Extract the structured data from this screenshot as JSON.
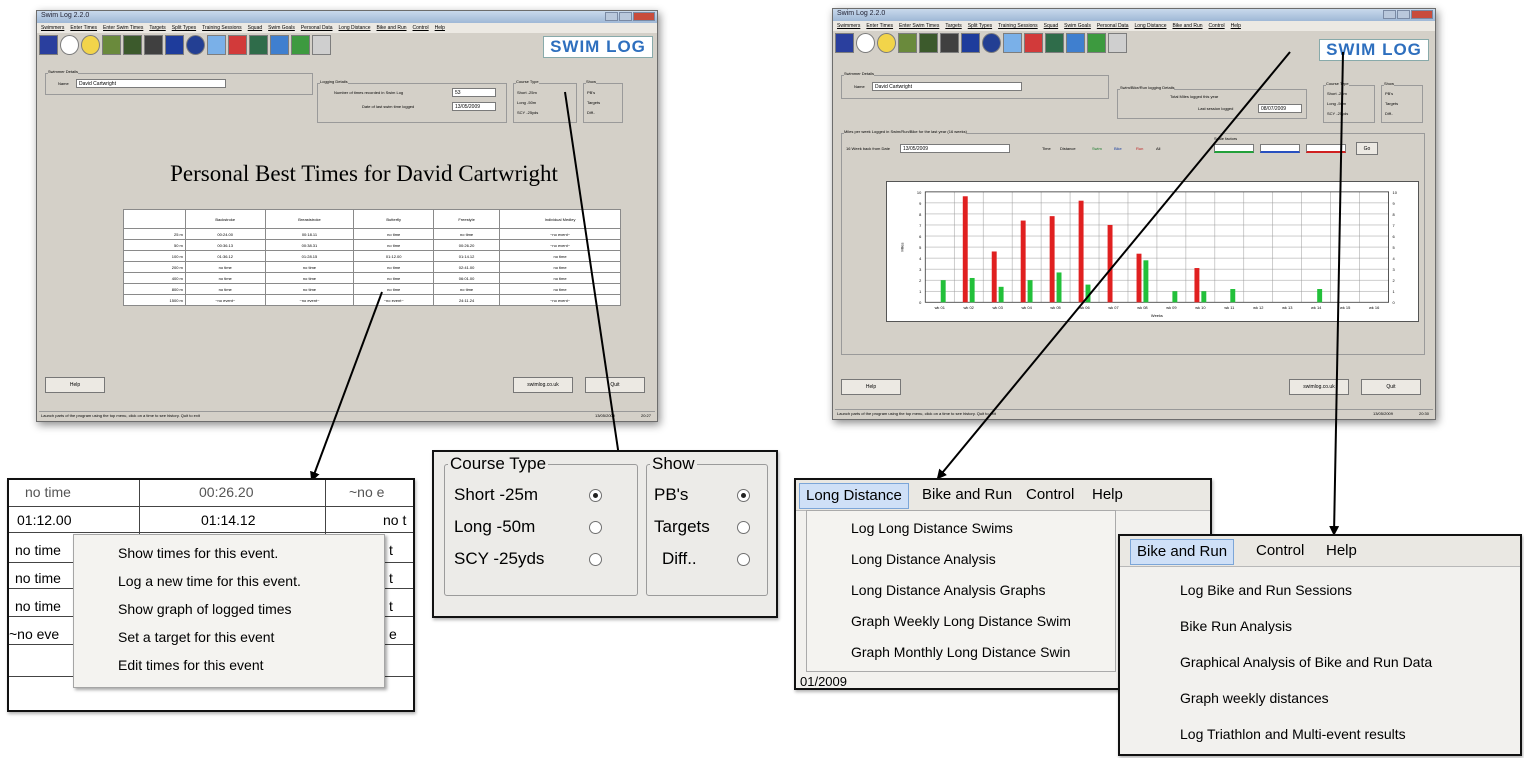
{
  "window_left": {
    "title": "Swim Log 2.2.0",
    "menu": [
      "Swimmers",
      "Enter Times",
      "Enter Swim Times",
      "Targets",
      "Split Types",
      "Training Sessions",
      "Squad",
      "Swim Goals",
      "Personal Data",
      "Long Distance",
      "Bike and Run",
      "Control",
      "Help"
    ],
    "logo": "SWIM LOG",
    "swimmer_details_label": "Swimmer Details",
    "name_label": "Name",
    "name_value": "David Cartwright",
    "logging_details_label": "Logging Details",
    "num_times_label": "Number of times recorded in Swim Log",
    "num_times_value": "53",
    "last_date_label": "Date of last swim time logged",
    "last_date_value": "13/05/2009",
    "course_type_label": "Course Type",
    "course_options": [
      "Short -25m",
      "Long -50m",
      "SCY -25yds"
    ],
    "show_label": "Show",
    "show_options": [
      "PB's",
      "Targets",
      "Diff.."
    ],
    "heading": "Personal Best Times for David Cartwright",
    "table": {
      "headers": [
        "",
        "Backstroke",
        "Breaststroke",
        "Butterfly",
        "Freestyle",
        "Individual Medley"
      ],
      "rows": [
        [
          "25 m",
          "00:24.00",
          "00:18.11",
          "no time",
          "no time",
          "~no event~"
        ],
        [
          "50 m",
          "00:36.13",
          "00:38.31",
          "no time",
          "00:26.20",
          "~no event~"
        ],
        [
          "100 m",
          "01:36.12",
          "01:28.15",
          "01:12.00",
          "01:14.12",
          "no time"
        ],
        [
          "200 m",
          "no time",
          "no time",
          "no time",
          "02:41.00",
          "no time"
        ],
        [
          "400 m",
          "no time",
          "no time",
          "no time",
          "06:01.00",
          "no time"
        ],
        [
          "800 m",
          "no time",
          "no time",
          "no time",
          "no time",
          "no time"
        ],
        [
          "1500 m",
          "~no event~",
          "~no event~",
          "~no event~",
          "24:11.24",
          "~no event~"
        ]
      ]
    },
    "help_button": "Help",
    "website_button": "swimlog.co.uk",
    "quit_button": "Quit",
    "status_text": "Launch parts of the program using the top menu, click on a time to see history. Quit to exit",
    "status_date": "13/05/2009",
    "status_time": "20:27"
  },
  "window_right": {
    "title": "Swim Log 2.2.0",
    "menu": [
      "Swimmers",
      "Enter Times",
      "Enter Swim Times",
      "Targets",
      "Split Types",
      "Training Sessions",
      "Squad",
      "Swim Goals",
      "Personal Data",
      "Long Distance",
      "Bike and Run",
      "Control",
      "Help"
    ],
    "logo": "SWIM LOG",
    "swimmer_details_label": "Swimmer Details",
    "name_label": "Name",
    "name_value": "David Cartwright",
    "bike_run_label": "Swim/Bike/Run logging Details",
    "total_miles_label": "Total Miles logged this year",
    "last_session_label": "Last session logged",
    "last_session_value": "08/07/2009",
    "course_type_label": "Course Type",
    "show_label": "Show",
    "miles_label": "Miles per week Logged in Swim/Run/Bike for the last year (16 weeks)",
    "week_back_label": "16 Week back from Date",
    "week_back_value": "13/05/2009",
    "time_label": "Time",
    "distance_label": "Distance",
    "swim_label": "Swim",
    "bike_label": "Bike",
    "run_label": "Run",
    "all_label": "All",
    "scale_label": "Scale factors",
    "go_button": "Go",
    "help_button": "Help",
    "website_button": "swimlog.co.uk",
    "quit_button": "Quit",
    "status_text": "Launch parts of the program using the top menu, click on a time to see history. Quit to exit",
    "status_date": "13/05/2009",
    "status_time": "20:30"
  },
  "chart_data": {
    "type": "bar",
    "ylabel": "Miles",
    "xlabel": "Weeks",
    "ylim": [
      0,
      10
    ],
    "categories": [
      "wk 01",
      "wk 02",
      "wk 03",
      "wk 04",
      "wk 05",
      "wk 06",
      "wk 07",
      "wk 08",
      "wk 09",
      "wk 10",
      "wk 11",
      "wk 12",
      "wk 13",
      "wk 14",
      "wk 15",
      "wk 16"
    ],
    "series": [
      {
        "color": "#e02020",
        "values": [
          0,
          9.6,
          4.6,
          7.4,
          7.8,
          9.2,
          7.0,
          4.4,
          0,
          3.1,
          0,
          0,
          0,
          0,
          0,
          0
        ]
      },
      {
        "color": "#22c03a",
        "values": [
          2.0,
          2.2,
          1.4,
          2.0,
          2.7,
          1.6,
          0,
          3.8,
          1.0,
          1.0,
          1.2,
          0,
          0,
          1.2,
          0,
          0
        ]
      }
    ]
  },
  "zoom_context": {
    "top_cells": [
      "no time",
      "00:26.20",
      "~no e"
    ],
    "row_cells": [
      "01:12.00",
      "01:14.12",
      "no t"
    ],
    "side_cells": [
      "no time",
      "no time",
      "no time",
      "~no eve"
    ],
    "right_cells": [
      "t",
      "t",
      "t",
      "e"
    ],
    "menu": [
      "Show times for this event.",
      "Log a new time for this event.",
      "Show graph of logged times",
      "Set a target for this event",
      "Edit times for this event"
    ]
  },
  "zoom_course": {
    "course_type_label": "Course Type",
    "course_options": [
      "Short -25m",
      "Long -50m",
      "SCY -25yds"
    ],
    "show_label": "Show",
    "show_options": [
      "PB's",
      "Targets",
      "Diff.."
    ]
  },
  "zoom_long_distance": {
    "menubar": [
      "Long Distance",
      "Bike and Run",
      "Control",
      "Help"
    ],
    "items": [
      "Log Long Distance Swims",
      "Long Distance Analysis",
      "Long Distance Analysis Graphs",
      "Graph Weekly Long Distance Swim",
      "Graph Monthly Long Distance Swin"
    ],
    "footer_text": "01/2009"
  },
  "zoom_bike_run": {
    "menubar": [
      "Bike and Run",
      "Control",
      "Help"
    ],
    "items": [
      "Log Bike and Run Sessions",
      "Bike Run Analysis",
      "Graphical Analysis of Bike and Run Data",
      "Graph weekly distances",
      "Log Triathlon and Multi-event results"
    ]
  }
}
